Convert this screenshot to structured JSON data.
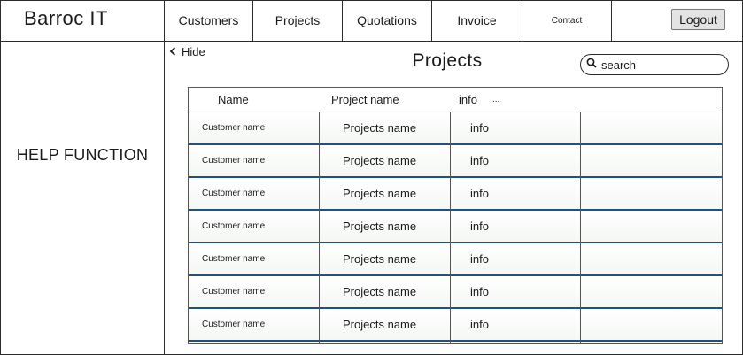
{
  "app": {
    "title": "Barroc IT"
  },
  "nav": {
    "items": [
      {
        "label": "Customers"
      },
      {
        "label": "Projects"
      },
      {
        "label": "Quotations"
      },
      {
        "label": "Invoice"
      },
      {
        "label": "Contact"
      }
    ],
    "logout_label": "Logout"
  },
  "help": {
    "label": "HELP FUNCTION"
  },
  "main": {
    "hide_label": "Hide",
    "title": "Projects",
    "search": {
      "placeholder": "search"
    }
  },
  "table": {
    "headers": {
      "name": "Name",
      "project": "Project name",
      "info": "info",
      "more": "..."
    },
    "rows": [
      {
        "customer": "Customer name",
        "project": "Projects name",
        "info": "info"
      },
      {
        "customer": "Customer name",
        "project": "Projects name",
        "info": "info"
      },
      {
        "customer": "Customer name",
        "project": "Projects name",
        "info": "info"
      },
      {
        "customer": "Customer name",
        "project": "Projects name",
        "info": "info"
      },
      {
        "customer": "Customer name",
        "project": "Projects name",
        "info": "info"
      },
      {
        "customer": "Customer name",
        "project": "Projects name",
        "info": "info"
      },
      {
        "customer": "Customer name",
        "project": "Projects name",
        "info": "info"
      }
    ]
  },
  "icons": {
    "hide": "chevron-left-icon",
    "search": "search-icon"
  },
  "colors": {
    "row_border": "#24507e",
    "logout_bg": "#e3e3e3"
  }
}
